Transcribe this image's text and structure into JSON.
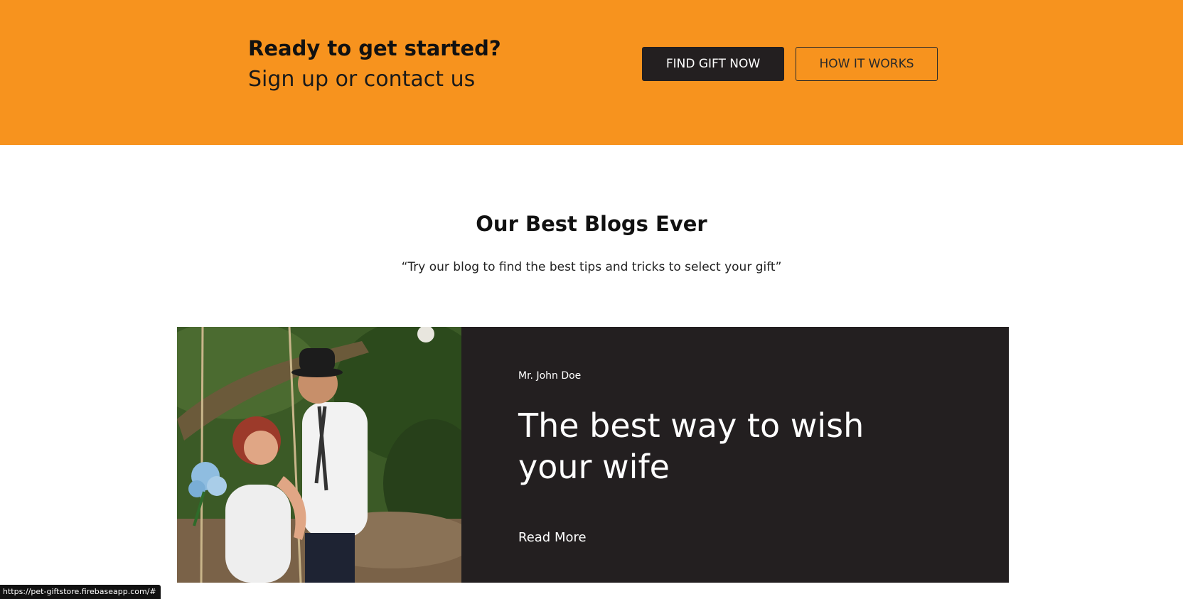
{
  "cta": {
    "heading": "Ready to get started?",
    "subheading": "Sign up or contact us",
    "primary_button": "FIND GIFT NOW",
    "secondary_button": "HOW IT WORKS",
    "background_color": "#f7931e"
  },
  "blogs": {
    "title": "Our Best Blogs Ever",
    "subtitle": "“Try our blog to find the best tips and tricks to select your gift”",
    "featured": {
      "author": "Mr. John Doe",
      "title": "The best way to wish your wife",
      "read_more": "Read More",
      "card_color": "#231f20"
    }
  },
  "status_bar": {
    "url": "https://pet-giftstore.firebaseapp.com/#"
  }
}
